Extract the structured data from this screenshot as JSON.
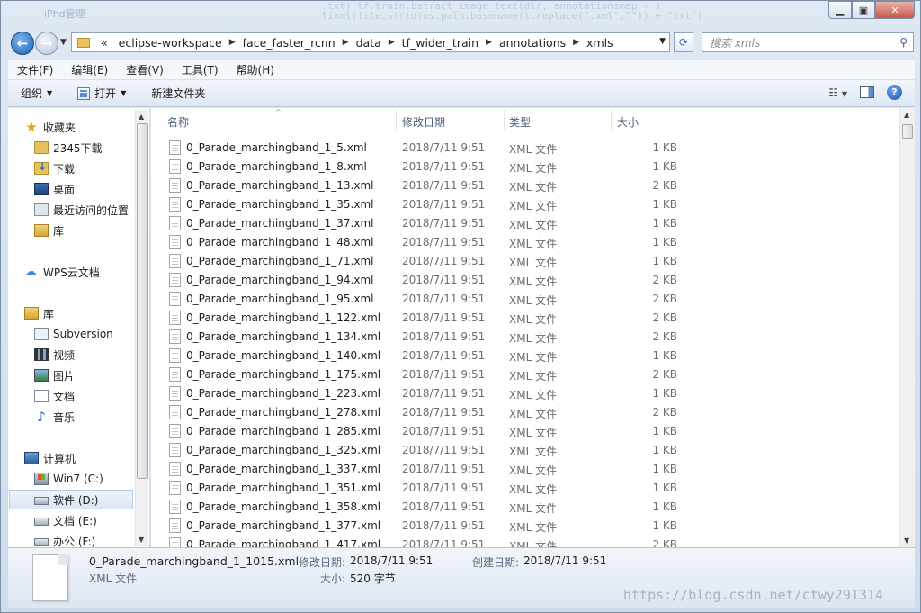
{
  "window": {
    "ghost_title": "iPhd管理",
    "ghost_code": "    .txt) tf.train.bstract_image_text(dir, annotationsmap = )\n    lixml(file.strtd(os.path.basename(t.replace(\".xml\",\"\")) + \"txt\")"
  },
  "address": {
    "overflow": "«",
    "segments": [
      "eclipse-workspace",
      "face_faster_rcnn",
      "data",
      "tf_wider_train",
      "annotations",
      "xmls"
    ]
  },
  "search": {
    "placeholder": "搜索 xmls"
  },
  "menu": [
    "文件(F)",
    "编辑(E)",
    "查看(V)",
    "工具(T)",
    "帮助(H)"
  ],
  "toolbar": {
    "organize": "组织",
    "open": "打开",
    "new_folder": "新建文件夹"
  },
  "nav": {
    "favorites": "收藏夹",
    "fav_items": [
      "2345下载",
      "下载",
      "桌面",
      "最近访问的位置",
      "库"
    ],
    "wps": "WPS云文档",
    "library": "库",
    "lib_items": [
      "Subversion",
      "视频",
      "图片",
      "文档",
      "音乐"
    ],
    "computer": "计算机",
    "drives": [
      "Win7 (C:)",
      "软件 (D:)",
      "文档 (E:)",
      "办公 (F:)"
    ]
  },
  "columns": {
    "name": "名称",
    "date": "修改日期",
    "type": "类型",
    "size": "大小"
  },
  "files": [
    {
      "name": "0_Parade_marchingband_1_5.xml",
      "date": "2018/7/11 9:51",
      "type": "XML 文件",
      "size": "1 KB"
    },
    {
      "name": "0_Parade_marchingband_1_8.xml",
      "date": "2018/7/11 9:51",
      "type": "XML 文件",
      "size": "1 KB"
    },
    {
      "name": "0_Parade_marchingband_1_13.xml",
      "date": "2018/7/11 9:51",
      "type": "XML 文件",
      "size": "2 KB"
    },
    {
      "name": "0_Parade_marchingband_1_35.xml",
      "date": "2018/7/11 9:51",
      "type": "XML 文件",
      "size": "1 KB"
    },
    {
      "name": "0_Parade_marchingband_1_37.xml",
      "date": "2018/7/11 9:51",
      "type": "XML 文件",
      "size": "1 KB"
    },
    {
      "name": "0_Parade_marchingband_1_48.xml",
      "date": "2018/7/11 9:51",
      "type": "XML 文件",
      "size": "1 KB"
    },
    {
      "name": "0_Parade_marchingband_1_71.xml",
      "date": "2018/7/11 9:51",
      "type": "XML 文件",
      "size": "1 KB"
    },
    {
      "name": "0_Parade_marchingband_1_94.xml",
      "date": "2018/7/11 9:51",
      "type": "XML 文件",
      "size": "2 KB"
    },
    {
      "name": "0_Parade_marchingband_1_95.xml",
      "date": "2018/7/11 9:51",
      "type": "XML 文件",
      "size": "2 KB"
    },
    {
      "name": "0_Parade_marchingband_1_122.xml",
      "date": "2018/7/11 9:51",
      "type": "XML 文件",
      "size": "2 KB"
    },
    {
      "name": "0_Parade_marchingband_1_134.xml",
      "date": "2018/7/11 9:51",
      "type": "XML 文件",
      "size": "2 KB"
    },
    {
      "name": "0_Parade_marchingband_1_140.xml",
      "date": "2018/7/11 9:51",
      "type": "XML 文件",
      "size": "1 KB"
    },
    {
      "name": "0_Parade_marchingband_1_175.xml",
      "date": "2018/7/11 9:51",
      "type": "XML 文件",
      "size": "2 KB"
    },
    {
      "name": "0_Parade_marchingband_1_223.xml",
      "date": "2018/7/11 9:51",
      "type": "XML 文件",
      "size": "1 KB"
    },
    {
      "name": "0_Parade_marchingband_1_278.xml",
      "date": "2018/7/11 9:51",
      "type": "XML 文件",
      "size": "2 KB"
    },
    {
      "name": "0_Parade_marchingband_1_285.xml",
      "date": "2018/7/11 9:51",
      "type": "XML 文件",
      "size": "1 KB"
    },
    {
      "name": "0_Parade_marchingband_1_325.xml",
      "date": "2018/7/11 9:51",
      "type": "XML 文件",
      "size": "1 KB"
    },
    {
      "name": "0_Parade_marchingband_1_337.xml",
      "date": "2018/7/11 9:51",
      "type": "XML 文件",
      "size": "1 KB"
    },
    {
      "name": "0_Parade_marchingband_1_351.xml",
      "date": "2018/7/11 9:51",
      "type": "XML 文件",
      "size": "1 KB"
    },
    {
      "name": "0_Parade_marchingband_1_358.xml",
      "date": "2018/7/11 9:51",
      "type": "XML 文件",
      "size": "1 KB"
    },
    {
      "name": "0_Parade_marchingband_1_377.xml",
      "date": "2018/7/11 9:51",
      "type": "XML 文件",
      "size": "1 KB"
    },
    {
      "name": "0_Parade_marchingband_1_417.xml",
      "date": "2018/7/11 9:51",
      "type": "XML 文件",
      "size": "2 KB"
    }
  ],
  "details": {
    "filename": "0_Parade_marchingband_1_1015.xml",
    "filetype": "XML 文件",
    "modified_label": "修改日期:",
    "modified": "2018/7/11 9:51",
    "created_label": "创建日期:",
    "created": "2018/7/11 9:51",
    "size_label": "大小:",
    "size": "520 字节"
  },
  "watermark": "https://blog.csdn.net/ctwy291314"
}
